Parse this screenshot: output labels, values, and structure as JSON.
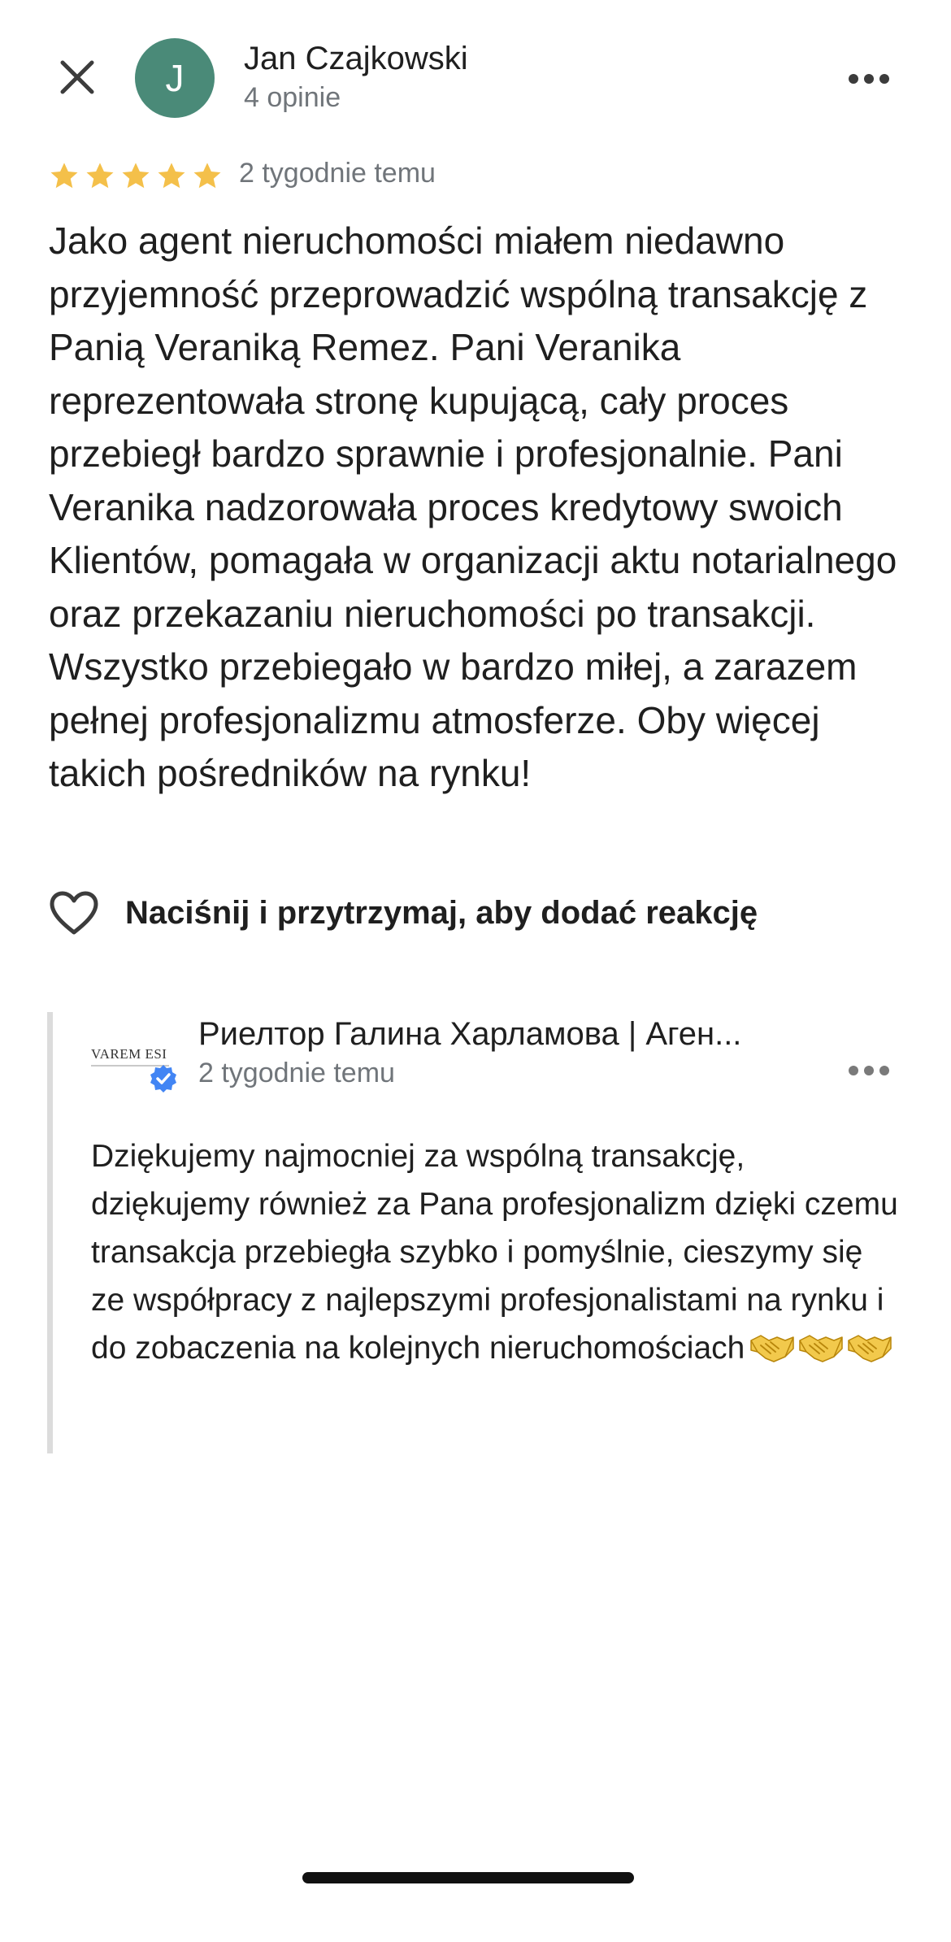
{
  "header": {
    "avatar_initial": "J",
    "avatar_color": "#4a8a78",
    "author_name": "Jan Czajkowski",
    "author_reviews": "4 opinie",
    "close_icon": "close-icon",
    "more_icon": "more-horizontal-icon"
  },
  "review": {
    "rating": 5,
    "rating_max": 5,
    "star_color": "#f4c04a",
    "time": "2 tygodnie temu",
    "text": "Jako agent nieruchomości miałem  niedawno przyjemność przeprowadzić wspólną transakcję z Panią Veraniką Remez. Pani Veranika reprezentowała stronę kupującą, cały proces przebiegł bardzo sprawnie i profesjonalnie. Pani Veranika nadzorowała proces kredytowy swoich Klientów, pomagała w organizacji aktu notarialnego oraz przekazaniu nieruchomości po transakcji. Wszystko przebiegało w bardzo miłej, a zarazem pełnej profesjonalizmu atmosferze. Oby więcej takich pośredników na rynku!"
  },
  "reaction": {
    "icon": "heart-outline-icon",
    "label": "Naciśnij i przytrzymaj, aby dodać reakcję"
  },
  "owner_reply": {
    "logo_text": "VAREM ESI",
    "verified_icon": "verified-badge-icon",
    "verified_color": "#4285f4",
    "owner_name": "Риелтор Галина Харламова | Аген...",
    "time": "2 tygodnie temu",
    "text": "Dziękujemy najmocniej za wspólną transakcję, dziękujemy również za Pana profesjonalizm dzięki czemu transakcja przebiegła szybko i pomyślnie, cieszymy się ze współpracy z najlepszymi profesjonalistami na rynku i do zobaczenia na kolejnych nieruchomościach",
    "emoji_icon": "handshake-icon",
    "emoji_count": 3
  }
}
